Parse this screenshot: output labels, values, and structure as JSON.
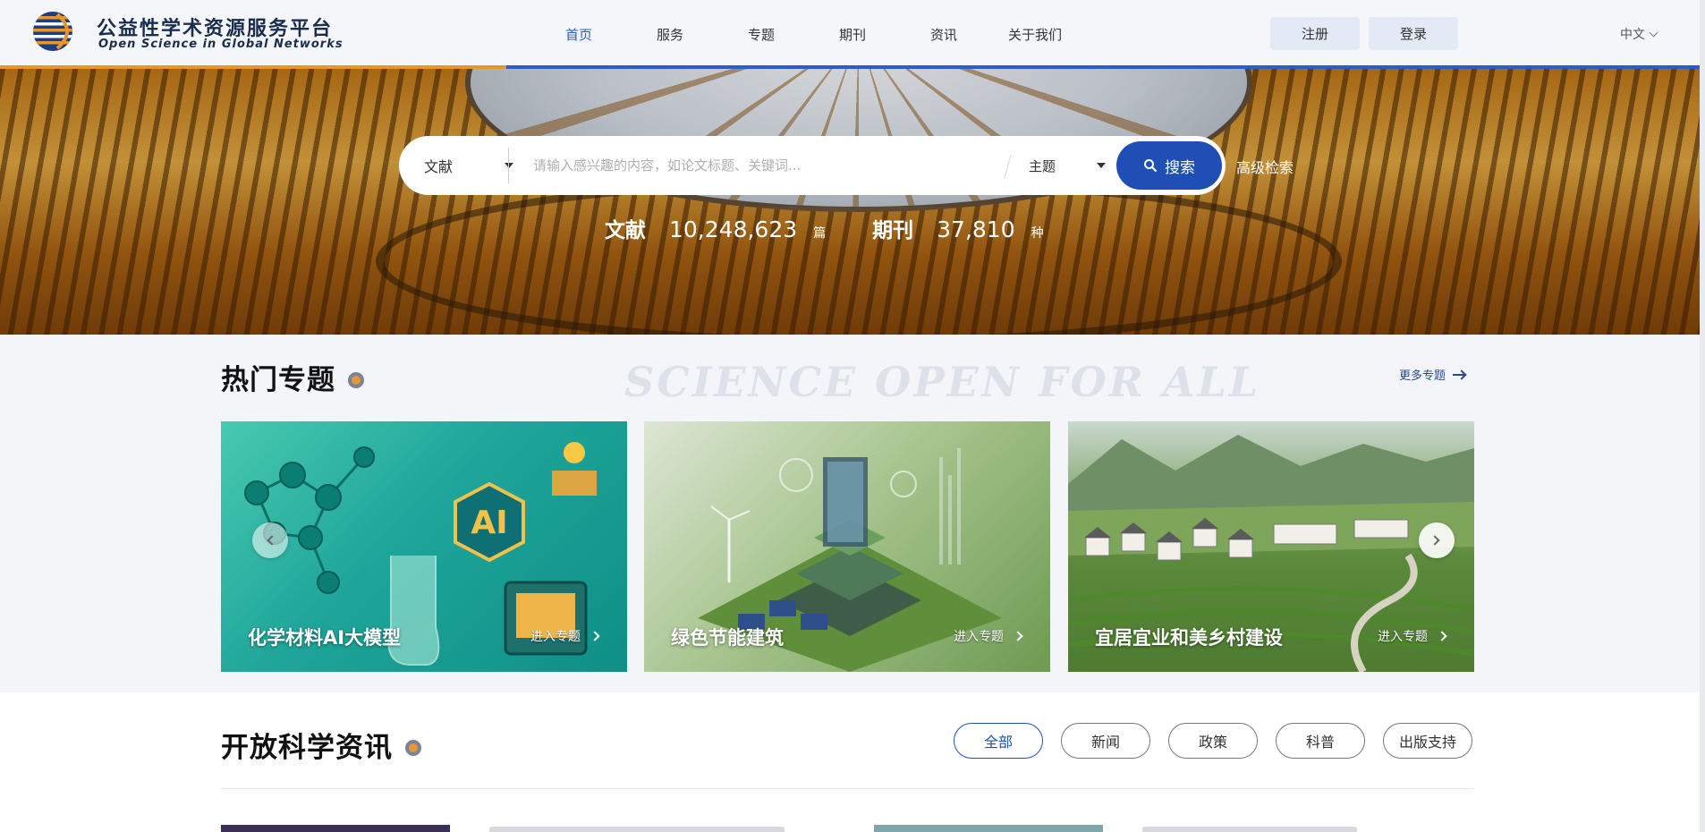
{
  "header": {
    "brand_title": "公益性学术资源服务平台",
    "brand_subtitle": "Open Science in Global Networks",
    "nav": [
      {
        "label": "首页",
        "active": true
      },
      {
        "label": "服务",
        "active": false
      },
      {
        "label": "专题",
        "active": false
      },
      {
        "label": "期刊",
        "active": false
      },
      {
        "label": "资讯",
        "active": false
      },
      {
        "label": "关于我们",
        "active": false
      }
    ],
    "register_label": "注册",
    "login_label": "登录",
    "language": "中文"
  },
  "search": {
    "scope_selected": "文献",
    "placeholder": "请输入感兴趣的内容，如论文标题、关键词...",
    "field_selected": "主题",
    "button_label": "搜索",
    "advanced_label": "高级检索"
  },
  "stats": [
    {
      "label": "文献",
      "value": "10,248,623",
      "unit": "篇"
    },
    {
      "label": "期刊",
      "value": "37,810",
      "unit": "种"
    }
  ],
  "topics": {
    "title": "热门专题",
    "watermark": "SCIENCE OPEN FOR ALL",
    "more_label": "更多专题",
    "cards": [
      {
        "title": "化学材料AI大模型",
        "enter_label": "进入专题"
      },
      {
        "title": "绿色节能建筑",
        "enter_label": "进入专题"
      },
      {
        "title": "宜居宜业和美乡村建设",
        "enter_label": "进入专题"
      }
    ]
  },
  "news": {
    "title": "开放科学资讯",
    "tabs": [
      {
        "label": "全部",
        "active": true
      },
      {
        "label": "新闻",
        "active": false
      },
      {
        "label": "政策",
        "active": false
      },
      {
        "label": "科普",
        "active": false
      },
      {
        "label": "出版支持",
        "active": false
      }
    ]
  },
  "colors": {
    "primary": "#1f4fb5",
    "accent_orange": "#e8962a",
    "nav_active": "#2b5cc8"
  }
}
